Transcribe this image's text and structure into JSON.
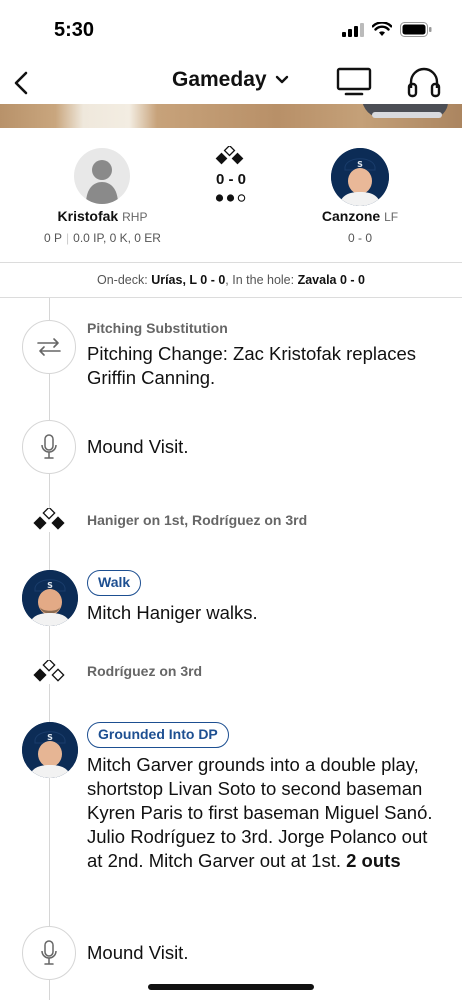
{
  "status_bar": {
    "time": "5:30"
  },
  "nav": {
    "title": "Gameday",
    "icons": [
      "back-chevron-icon",
      "chevron-down-icon",
      "tv-icon",
      "headphones-icon"
    ]
  },
  "matchup": {
    "pitcher": {
      "name": "Kristofak",
      "position": "RHP",
      "pitches": "0 P",
      "line": "0.0 IP, 0 K, 0 ER"
    },
    "count": "0 - 0",
    "outs": 2,
    "batter": {
      "name": "Canzone",
      "position": "LF",
      "line": "0 - 0"
    }
  },
  "ondeck": {
    "ondeck_label": "On-deck:",
    "ondeck_value": "Urías, L 0 - 0",
    "hole_label": "In the hole:",
    "hole_value": "Zavala 0 - 0"
  },
  "events": [
    {
      "label": "Pitching Substitution",
      "text": "Pitching Change: Zac Kristofak replaces Griffin Canning.",
      "icon": "substitution-arrows-icon"
    },
    {
      "text": "Mound Visit.",
      "icon": "microphone-icon"
    },
    {
      "label": "Haniger on 1st, Rodríguez on 3rd",
      "icon": "bases-icon"
    },
    {
      "badge": "Walk",
      "text": "Mitch Haniger walks.",
      "icon": "player-photo"
    },
    {
      "label": "Rodríguez on 3rd",
      "icon": "bases-icon"
    },
    {
      "badge": "Grounded Into DP",
      "text": "Mitch Garver grounds into a double play, shortstop Livan Soto to second baseman Kyren Paris to first baseman Miguel Sanó. Julio Rodríguez to 3rd. Jorge Polanco out at 2nd. Mitch Garver out at 1st.",
      "text_bold": "2 outs",
      "icon": "player-photo"
    },
    {
      "text": "Mound Visit.",
      "icon": "microphone-icon"
    }
  ],
  "colors": {
    "accent": "#1d4f91",
    "team_navy": "#0c2c56",
    "muted": "#666666"
  }
}
